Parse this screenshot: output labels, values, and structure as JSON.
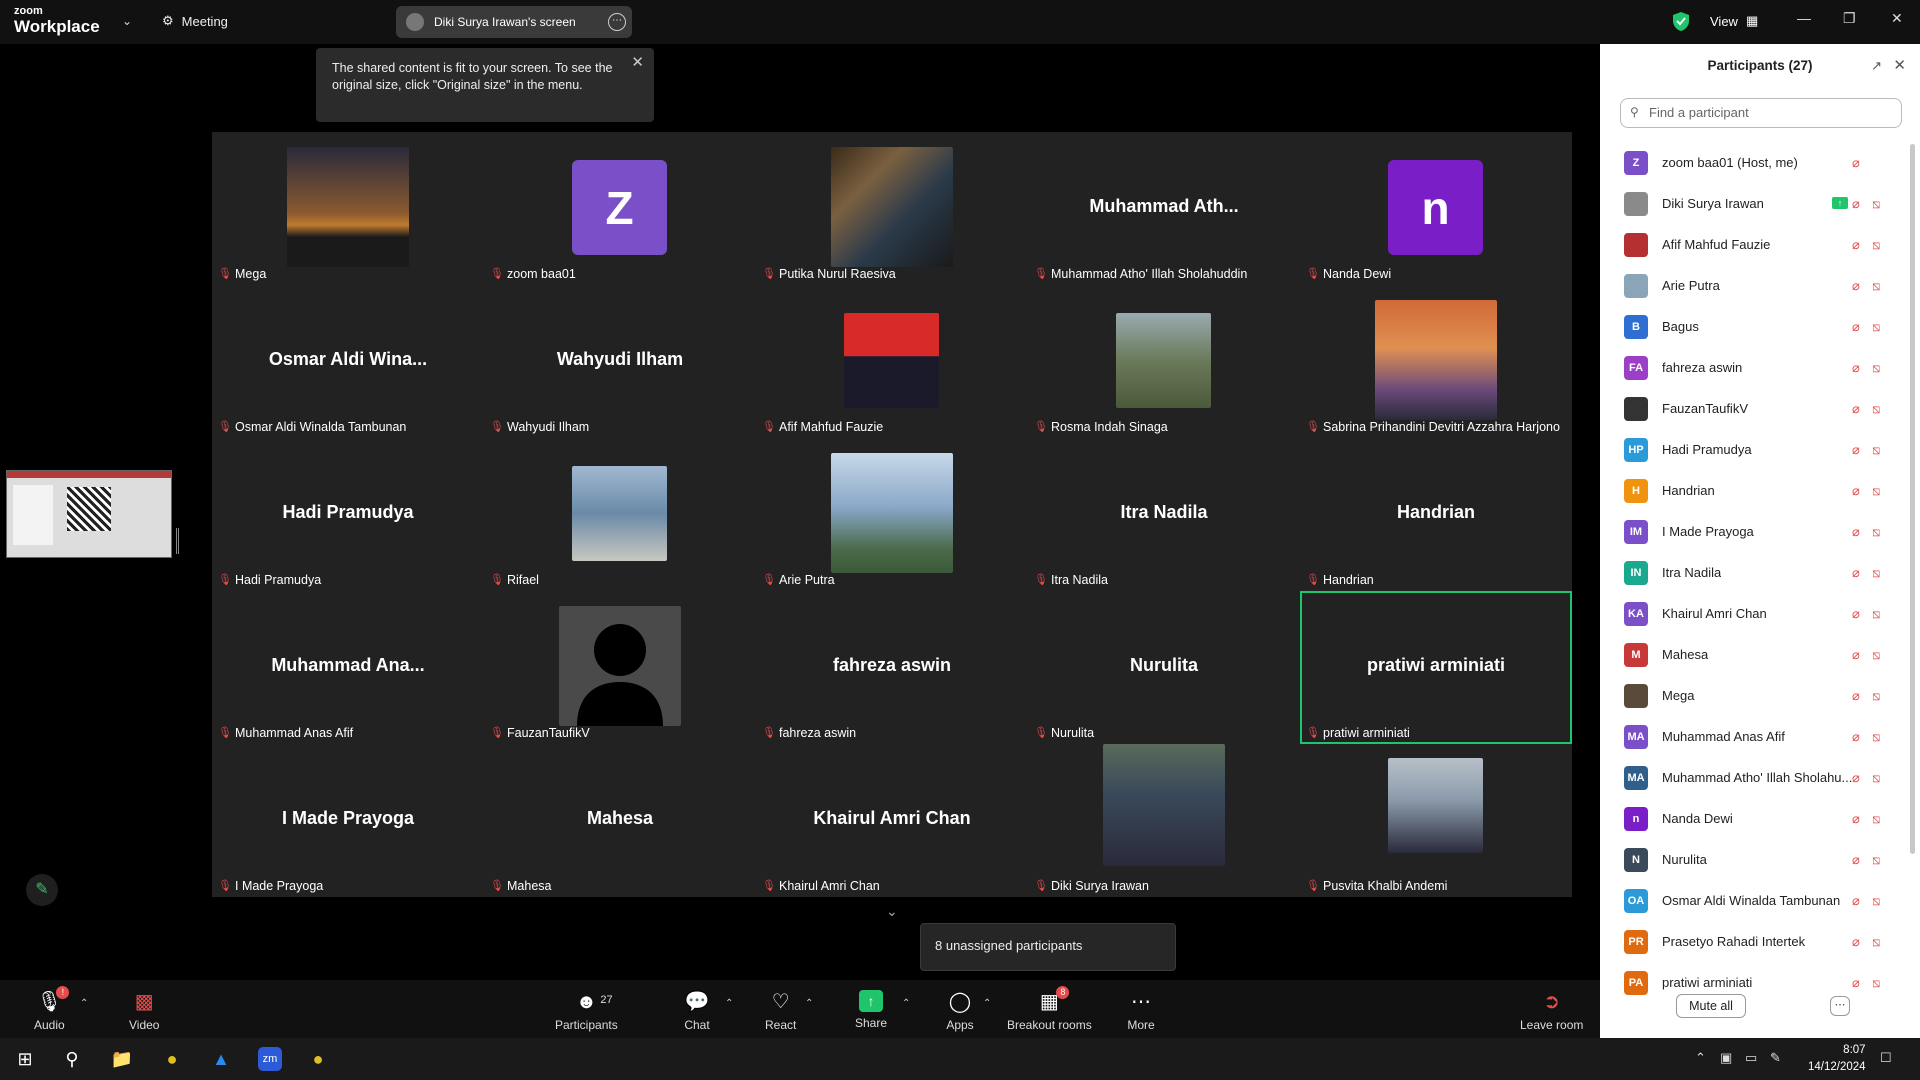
{
  "topbar": {
    "logo_small": "zoom",
    "logo_big": "Workplace",
    "meeting_label": "Meeting",
    "screen_pill": "Diki Surya Irawan's screen",
    "view_label": "View"
  },
  "tooltip": {
    "text": "The shared content is fit to your screen. To see the original size, click \"Original size\" in the menu."
  },
  "gallery": {
    "tiles": [
      {
        "name": "Mega",
        "big": ""
      },
      {
        "name": "zoom baa01",
        "big": "",
        "avatar_letter": "Z"
      },
      {
        "name": "Putika Nurul Raesiva",
        "big": ""
      },
      {
        "name": "Muhammad Atho' Illah Sholahuddin",
        "big": "Muhammad  Ath..."
      },
      {
        "name": "Nanda Dewi",
        "big": "",
        "avatar_letter": "n"
      },
      {
        "name": "Osmar Aldi Winalda Tambunan",
        "big": "Osmar  Aldi  Wina..."
      },
      {
        "name": "Wahyudi Ilham",
        "big": "Wahyudi Ilham"
      },
      {
        "name": "Afif Mahfud Fauzie",
        "big": ""
      },
      {
        "name": "Rosma Indah Sinaga",
        "big": ""
      },
      {
        "name": "Sabrina Prihandini Devitri Azzahra Harjono",
        "big": ""
      },
      {
        "name": "Hadi Pramudya",
        "big": "Hadi Pramudya"
      },
      {
        "name": "Rifael",
        "big": ""
      },
      {
        "name": "Arie Putra",
        "big": ""
      },
      {
        "name": "Itra Nadila",
        "big": "Itra Nadila"
      },
      {
        "name": "Handrian",
        "big": "Handrian"
      },
      {
        "name": "Muhammad Anas Afif",
        "big": "Muhammad  Ana..."
      },
      {
        "name": "FauzanTaufikV",
        "big": ""
      },
      {
        "name": "fahreza aswin",
        "big": "fahreza aswin"
      },
      {
        "name": "Nurulita",
        "big": "Nurulita"
      },
      {
        "name": "pratiwi arminiati",
        "big": "pratiwi arminiati"
      },
      {
        "name": "I Made Prayoga",
        "big": "I Made Prayoga"
      },
      {
        "name": "Mahesa",
        "big": "Mahesa"
      },
      {
        "name": "Khairul Amri Chan",
        "big": "Khairul Amri Chan"
      },
      {
        "name": "Diki Surya Irawan",
        "big": ""
      },
      {
        "name": "Pusvita Khalbi Andemi",
        "big": ""
      }
    ],
    "unassigned": "8 unassigned participants"
  },
  "panel": {
    "title": "Participants (27)",
    "search_placeholder": "Find a participant",
    "participants": [
      {
        "initials": "Z",
        "name": "zoom baa01 (Host, me)",
        "color": "#7a4fc8"
      },
      {
        "initials": "",
        "name": "Diki Surya Irawan",
        "color": "#8a8a8a"
      },
      {
        "initials": "",
        "name": "Afif Mahfud Fauzie",
        "color": "#b53030"
      },
      {
        "initials": "",
        "name": "Arie Putra",
        "color": "#8aa4b8"
      },
      {
        "initials": "B",
        "name": "Bagus",
        "color": "#2f6fd1"
      },
      {
        "initials": "FA",
        "name": "fahreza aswin",
        "color": "#9b3fc8"
      },
      {
        "initials": "",
        "name": "FauzanTaufikV",
        "color": "#333333"
      },
      {
        "initials": "HP",
        "name": "Hadi Pramudya",
        "color": "#2a9ad8"
      },
      {
        "initials": "H",
        "name": "Handrian",
        "color": "#f0930f"
      },
      {
        "initials": "IM",
        "name": "I Made Prayoga",
        "color": "#7a4fc8"
      },
      {
        "initials": "IN",
        "name": "Itra Nadila",
        "color": "#1aa88e"
      },
      {
        "initials": "KA",
        "name": "Khairul Amri Chan",
        "color": "#7a4fc8"
      },
      {
        "initials": "M",
        "name": "Mahesa",
        "color": "#c83a3a"
      },
      {
        "initials": "",
        "name": "Mega",
        "color": "#5a4a3a"
      },
      {
        "initials": "MA",
        "name": "Muhammad Anas Afif",
        "color": "#7a4fc8"
      },
      {
        "initials": "MA",
        "name": "Muhammad Atho' Illah Sholahu...",
        "color": "#2f5f8a"
      },
      {
        "initials": "n",
        "name": "Nanda Dewi",
        "color": "#7a1fc8"
      },
      {
        "initials": "N",
        "name": "Nurulita",
        "color": "#3a4a5a"
      },
      {
        "initials": "OA",
        "name": "Osmar Aldi Winalda Tambunan",
        "color": "#2a9ad8"
      },
      {
        "initials": "PR",
        "name": "Prasetyo Rahadi Intertek",
        "color": "#e06a10"
      },
      {
        "initials": "PA",
        "name": "pratiwi arminiati",
        "color": "#e06a10"
      }
    ],
    "mute_all": "Mute all"
  },
  "toolbar": {
    "audio": "Audio",
    "video": "Video",
    "participants": "Participants",
    "participants_count": "27",
    "chat": "Chat",
    "react": "React",
    "share": "Share",
    "apps": "Apps",
    "breakout": "Breakout rooms",
    "breakout_badge": "8",
    "more": "More",
    "leave": "Leave room",
    "audio_badge": "!"
  },
  "taskbar": {
    "time": "8:07",
    "date": "14/12/2024"
  }
}
